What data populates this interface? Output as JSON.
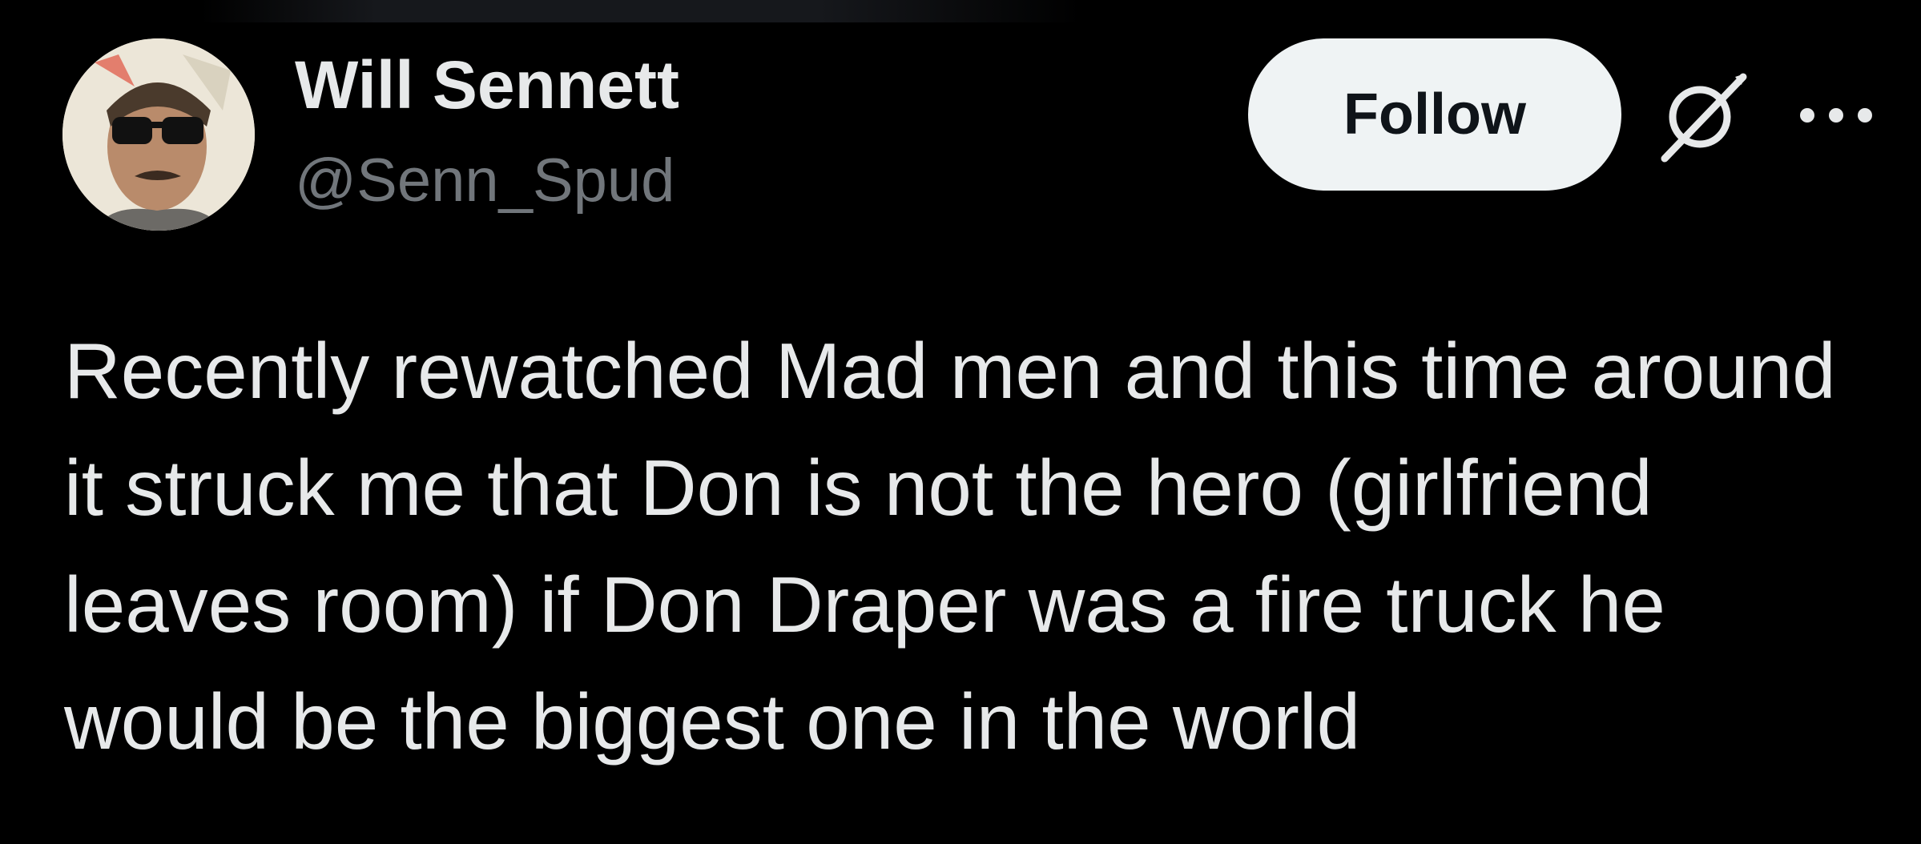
{
  "tweet": {
    "author": {
      "display_name": "Will Sennett",
      "handle": "@Senn_Spud",
      "avatar_icon": "avatar-photo"
    },
    "actions": {
      "follow_label": "Follow",
      "grok_icon": "grok-icon",
      "more_icon": "more-icon"
    },
    "text": "Recently rewatched Mad men and this time around it struck me that Don is not the hero (girlfriend leaves room) if Don Draper was a fire truck he would be the biggest one in the world"
  },
  "colors": {
    "background": "#000000",
    "primary_text": "#e7e9ea",
    "secondary_text": "#71767b",
    "follow_bg": "#eff3f4",
    "follow_text": "#0f1419"
  }
}
